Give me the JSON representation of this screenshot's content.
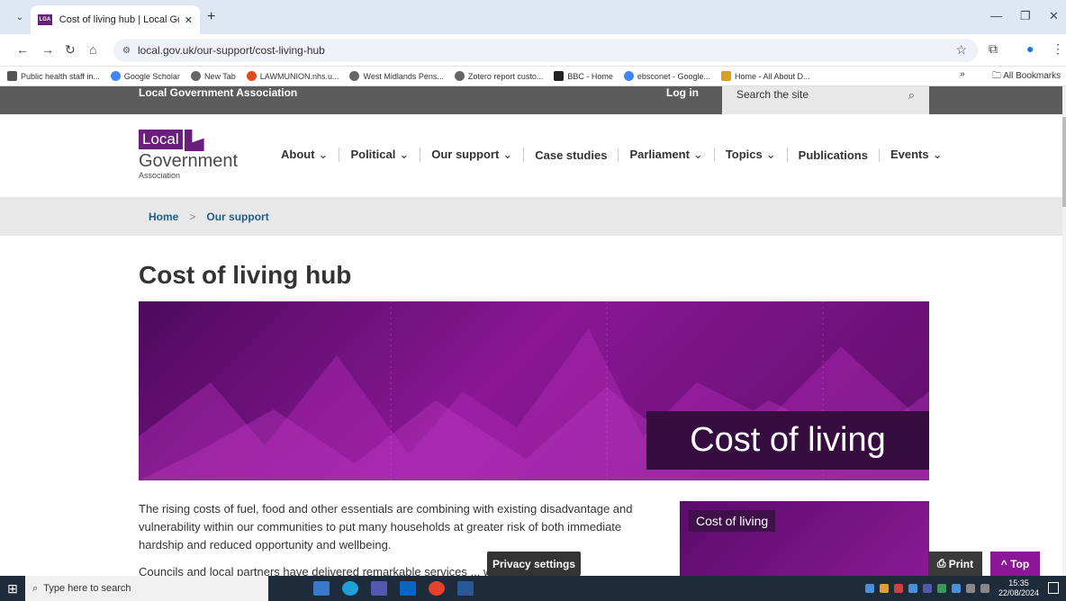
{
  "browser": {
    "tab_title": "Cost of living hub | Local Govern",
    "favicon_text": "LGA",
    "url": "local.gov.uk/our-support/cost-living-hub",
    "bookmarks": [
      "Public health staff in...",
      "Google Scholar",
      "New Tab",
      "LAWMUNION.nhs.u...",
      "West Midlands Pens...",
      "Zotero report custo...",
      "BBC - Home",
      "ebsconet - Google...",
      "Home - All About D..."
    ],
    "all_bookmarks": "All Bookmarks",
    "more_bookmarks": "»"
  },
  "site": {
    "org_name": "Local Government Association",
    "login": "Log in",
    "search_placeholder": "Search the site",
    "logo": {
      "local": "Local",
      "government": "Government",
      "association": "Association"
    },
    "nav": [
      {
        "label": "About",
        "dropdown": true
      },
      {
        "label": "Political",
        "dropdown": true
      },
      {
        "label": "Our support",
        "dropdown": true
      },
      {
        "label": "Case studies",
        "dropdown": false
      },
      {
        "label": "Parliament",
        "dropdown": true
      },
      {
        "label": "Topics",
        "dropdown": true
      },
      {
        "label": "Publications",
        "dropdown": false
      },
      {
        "label": "Events",
        "dropdown": true
      }
    ],
    "breadcrumb": {
      "home": "Home",
      "sep": ">",
      "current": "Our support"
    }
  },
  "page": {
    "title": "Cost of living hub",
    "hero_label": "Cost of living",
    "intro": "The rising costs of fuel, food and other essentials are combining with existing disadvantage and vulnerability within our communities to put many households at greater risk of both immediate hardship and reduced opportunity and wellbeing.",
    "intro2": "Councils and local partners have delivered remarkable services ... will continue",
    "sidecard_label": "Cost of living",
    "privacy": "Privacy settings",
    "print": "Print",
    "top": "Top"
  },
  "taskbar": {
    "search_placeholder": "Type here to search",
    "time": "15:35",
    "date": "22/08/2024"
  },
  "colors": {
    "brand": "#6b1f7c",
    "hero": "#8a1795",
    "topbar": "#5c5c5c"
  }
}
